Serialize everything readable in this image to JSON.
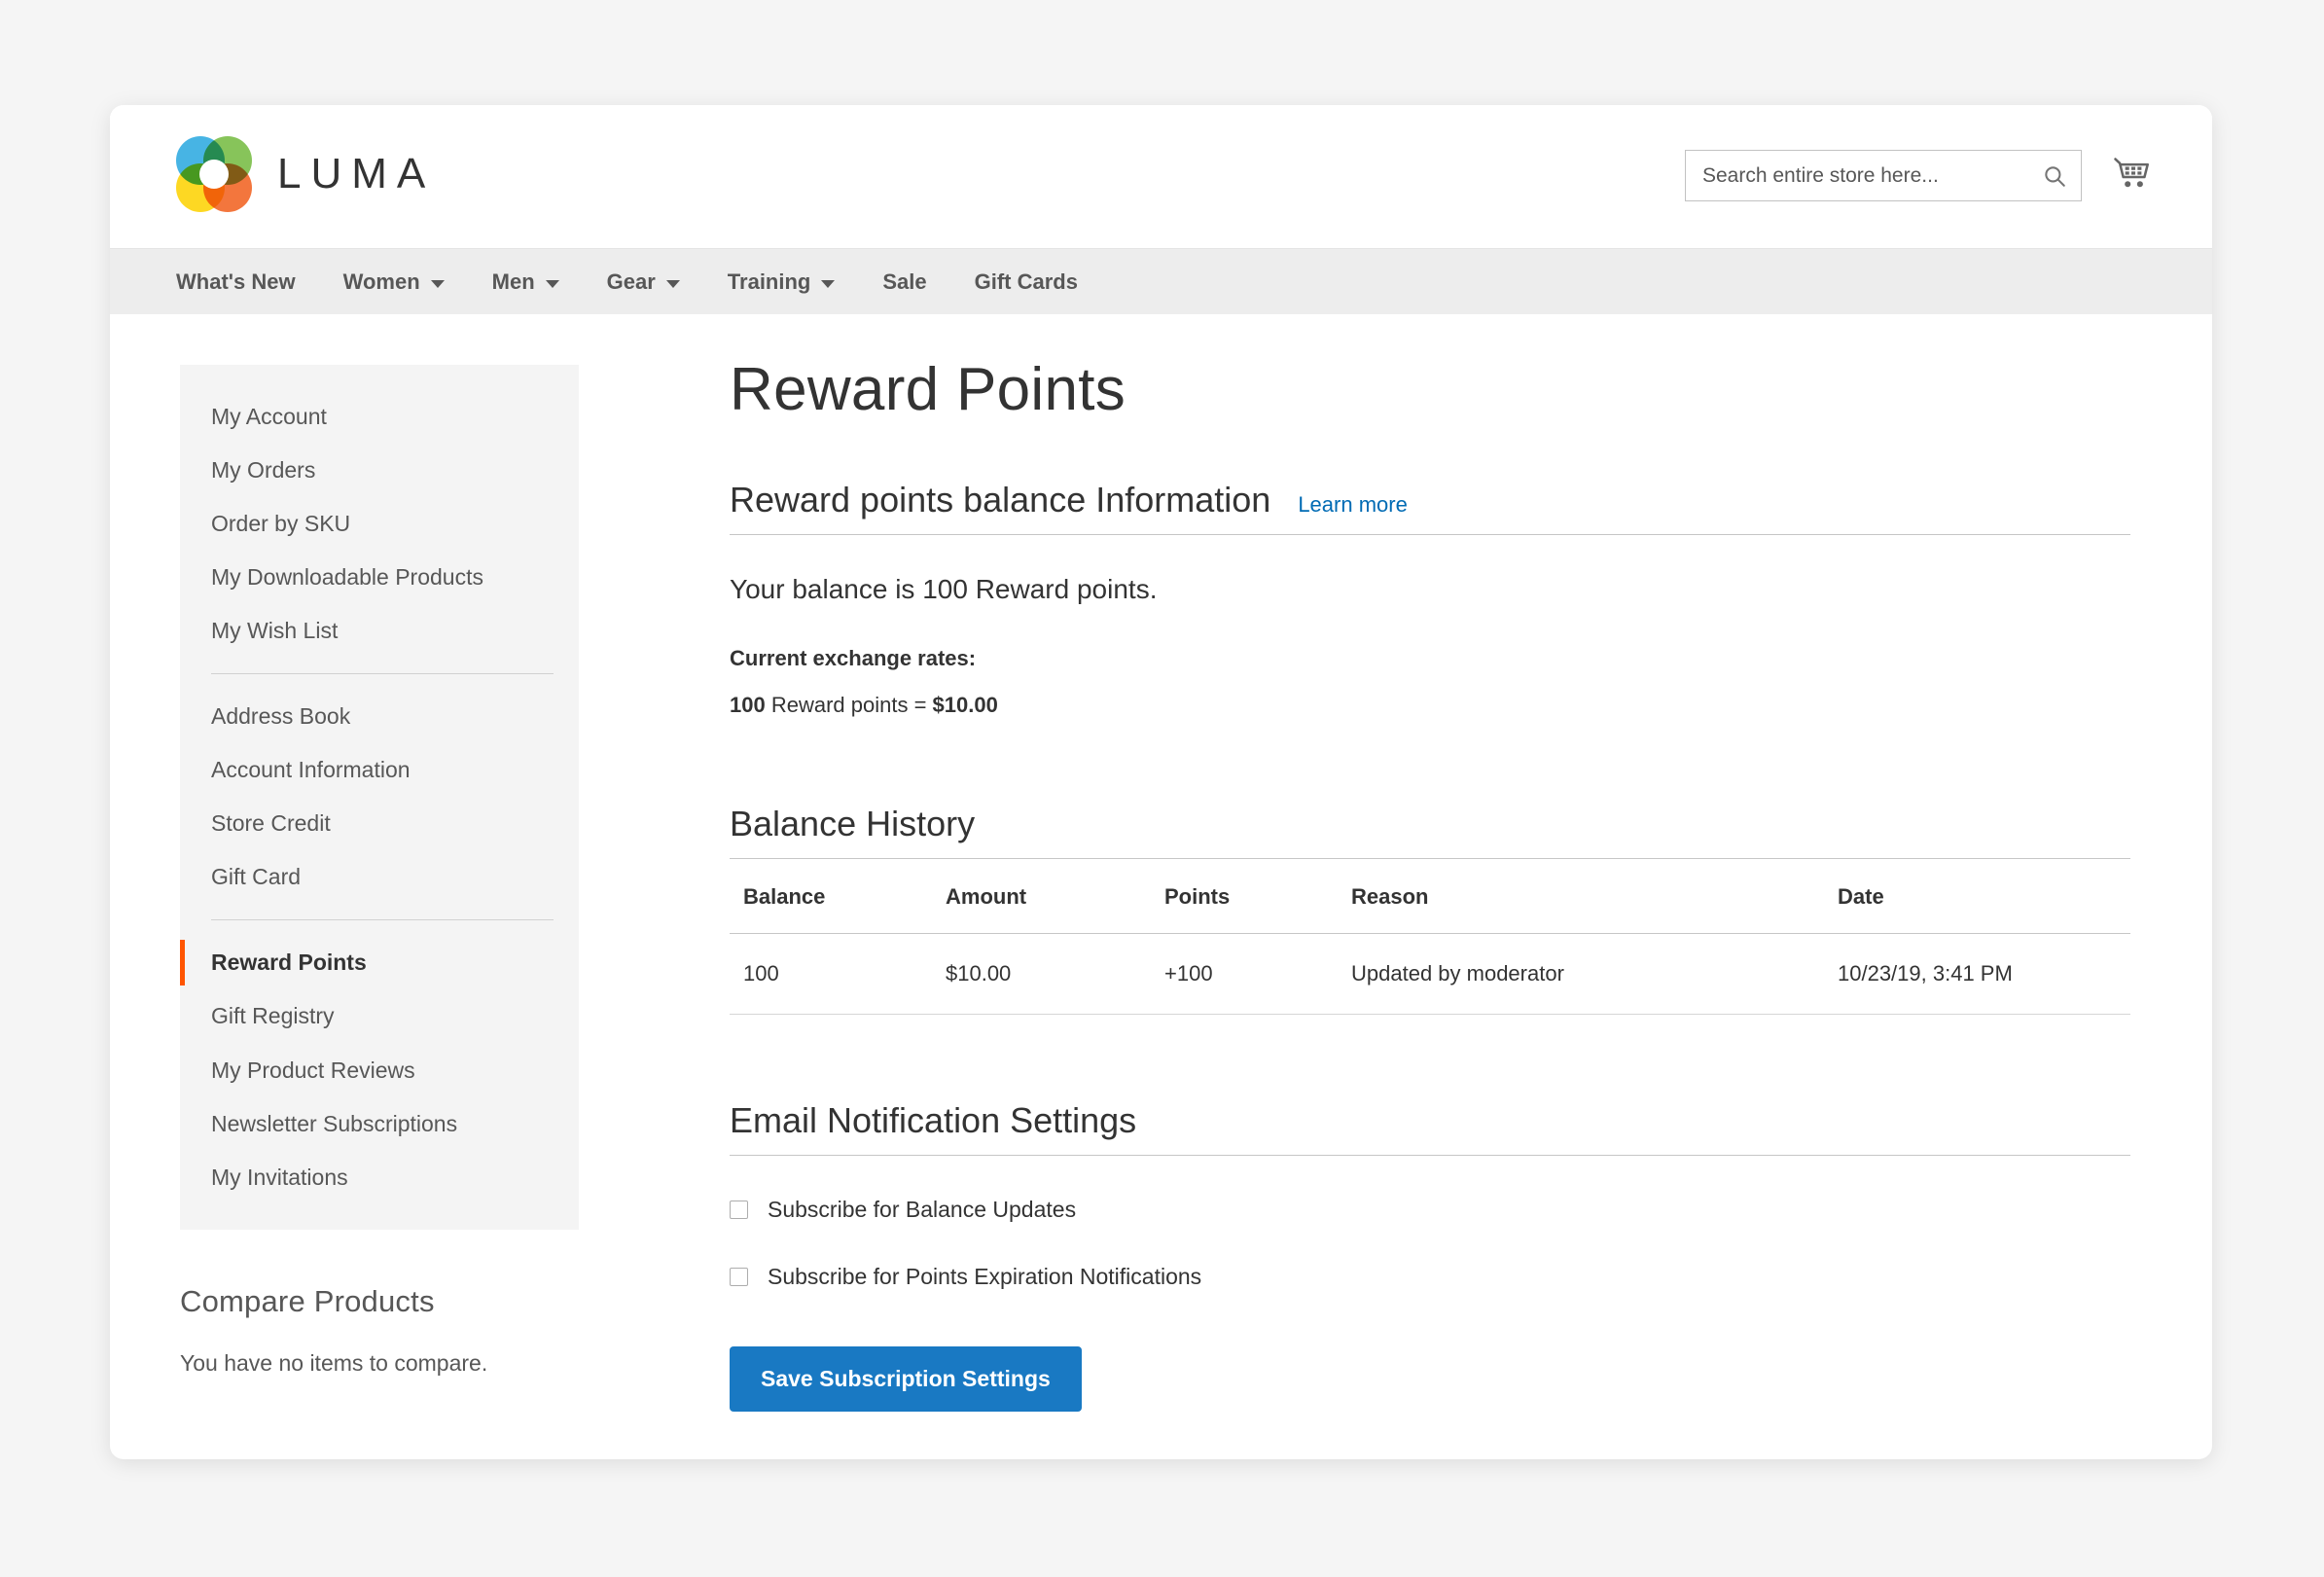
{
  "header": {
    "logo_text": "LUMA",
    "logo_colors": {
      "blue": "#2daae1",
      "green": "#76bc43",
      "orange": "#f26322",
      "yellow": "#fdd304"
    },
    "search": {
      "placeholder": "Search entire store here...",
      "value": ""
    },
    "cart_icon": "shopping-cart-icon"
  },
  "nav": {
    "items": [
      {
        "label": "What's New",
        "has_dropdown": false
      },
      {
        "label": "Women",
        "has_dropdown": true
      },
      {
        "label": "Men",
        "has_dropdown": true
      },
      {
        "label": "Gear",
        "has_dropdown": true
      },
      {
        "label": "Training",
        "has_dropdown": true
      },
      {
        "label": "Sale",
        "has_dropdown": false
      },
      {
        "label": "Gift Cards",
        "has_dropdown": false
      }
    ]
  },
  "sidebar": {
    "group1": [
      {
        "label": "My Account",
        "active": false
      },
      {
        "label": "My Orders",
        "active": false
      },
      {
        "label": "Order by SKU",
        "active": false
      },
      {
        "label": "My Downloadable Products",
        "active": false
      },
      {
        "label": "My Wish List",
        "active": false
      }
    ],
    "group2": [
      {
        "label": "Address Book",
        "active": false
      },
      {
        "label": "Account Information",
        "active": false
      },
      {
        "label": "Store Credit",
        "active": false
      },
      {
        "label": "Gift Card",
        "active": false
      }
    ],
    "group3": [
      {
        "label": "Reward Points",
        "active": true
      },
      {
        "label": "Gift Registry",
        "active": false
      },
      {
        "label": "My Product Reviews",
        "active": false
      },
      {
        "label": "Newsletter Subscriptions",
        "active": false
      },
      {
        "label": "My Invitations",
        "active": false
      }
    ],
    "active_accent_color": "#ff5501",
    "compare": {
      "title": "Compare Products",
      "empty_text": "You have no items to compare."
    }
  },
  "main": {
    "page_title": "Reward Points",
    "balance_section": {
      "heading": "Reward points balance Information",
      "learn_more": "Learn more",
      "learn_more_color": "#006bb4",
      "balance_text": "Your balance is 100 Reward points.",
      "rates_title": "Current exchange rates:",
      "rate_points": "100",
      "rate_middle": " Reward points = ",
      "rate_value": "$10.00"
    },
    "history": {
      "heading": "Balance History",
      "columns": [
        "Balance",
        "Amount",
        "Points",
        "Reason",
        "Date"
      ],
      "rows": [
        {
          "balance": "100",
          "amount": "$10.00",
          "points": "+100",
          "reason": "Updated by moderator",
          "date": "10/23/19, 3:41 PM"
        }
      ]
    },
    "notifications": {
      "heading": "Email Notification Settings",
      "checkboxes": [
        {
          "label": "Subscribe for Balance Updates",
          "checked": false
        },
        {
          "label": "Subscribe for Points Expiration Notifications",
          "checked": false
        }
      ],
      "save_label": "Save Subscription Settings",
      "save_color": "#1979c3"
    }
  }
}
